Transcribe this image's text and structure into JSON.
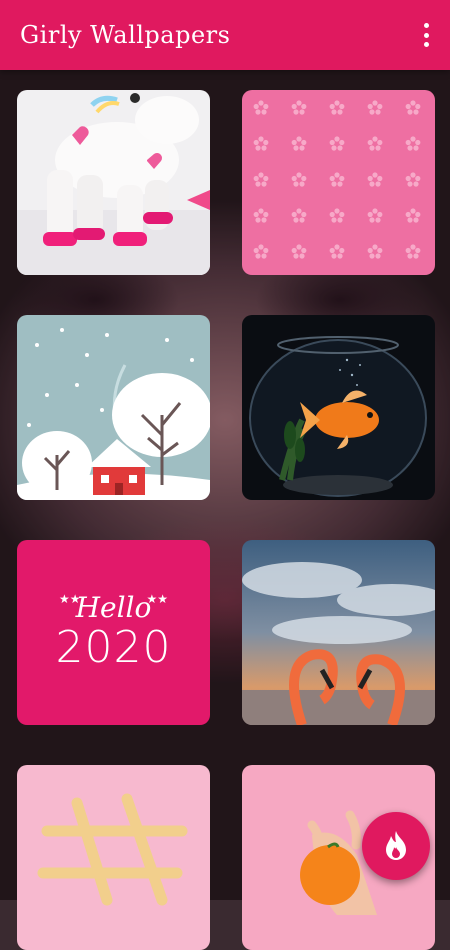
{
  "app": {
    "title": "Girly Wallpapers",
    "accent": "#e0195f"
  },
  "toolbar": {
    "overflow_menu_icon": "more-vert-icon"
  },
  "wallpapers": [
    {
      "name": "unicorn-pinata"
    },
    {
      "name": "pink-snowflake-pattern"
    },
    {
      "name": "winter-trees-house"
    },
    {
      "name": "goldfish-bowl"
    },
    {
      "name": "hello-2020",
      "text_line1": "Hello",
      "text_line2": "2020"
    },
    {
      "name": "flamingo-heart-sunset"
    },
    {
      "name": "hashtag-breadsticks"
    },
    {
      "name": "orange-in-hand"
    }
  ],
  "fab": {
    "icon": "flame-icon"
  }
}
